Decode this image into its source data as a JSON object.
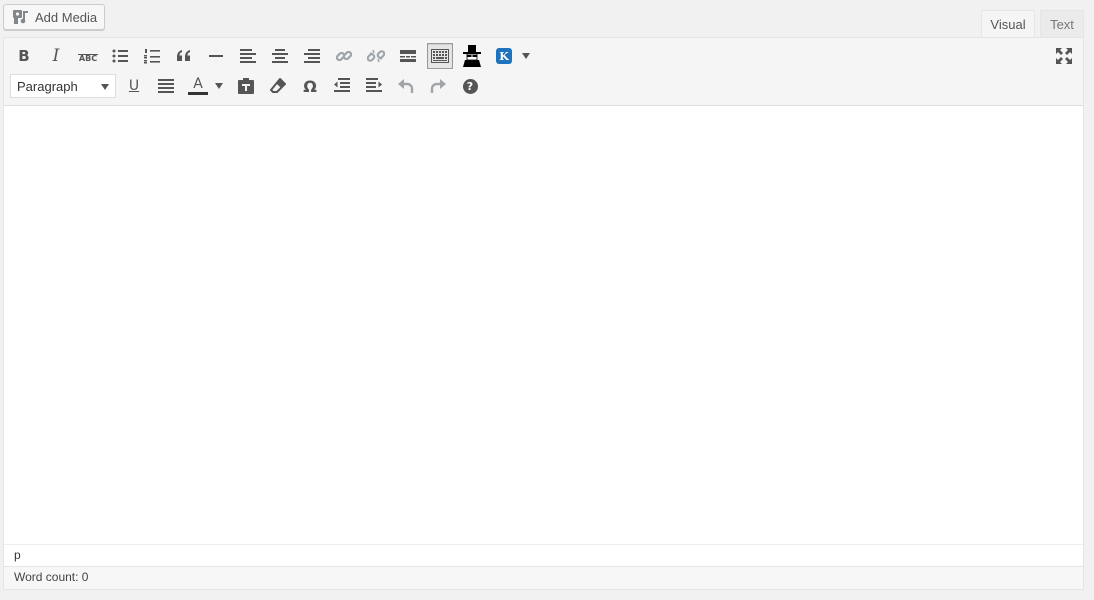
{
  "add_media": {
    "label": "Add Media",
    "icon": "media-icon"
  },
  "tabs": [
    {
      "label": "Visual",
      "active": true
    },
    {
      "label": "Text",
      "active": false
    }
  ],
  "toolbar": {
    "row1": [
      "bold",
      "italic",
      "strikethrough",
      "bulleted-list",
      "numbered-list",
      "blockquote",
      "horizontal-line",
      "align-left",
      "align-center",
      "align-right",
      "insert-link",
      "remove-link",
      "read-more",
      "toolbar-toggle",
      "spy-plugin",
      "k-plugin",
      "k-plugin-dropdown",
      "fullscreen"
    ],
    "row2": [
      "format-select",
      "underline",
      "justify",
      "text-color",
      "text-color-dropdown",
      "paste-as-text",
      "clear-formatting",
      "special-character",
      "decrease-indent",
      "increase-indent",
      "undo",
      "redo",
      "help"
    ],
    "bold_glyph": "B",
    "italic_glyph": "I",
    "strike_glyph": "ABC",
    "underline_glyph": "U",
    "color_glyph": "A",
    "omega_glyph": "Ω",
    "help_glyph": "?",
    "k_glyph": "K",
    "format_select": {
      "value": "Paragraph"
    }
  },
  "content": {
    "text": ""
  },
  "path": "p",
  "status": {
    "word_count": "Word count: 0"
  },
  "colors": {
    "icon": "#555555",
    "icon_disabled": "#a0a5aa",
    "k_plugin": "#1e73be"
  }
}
